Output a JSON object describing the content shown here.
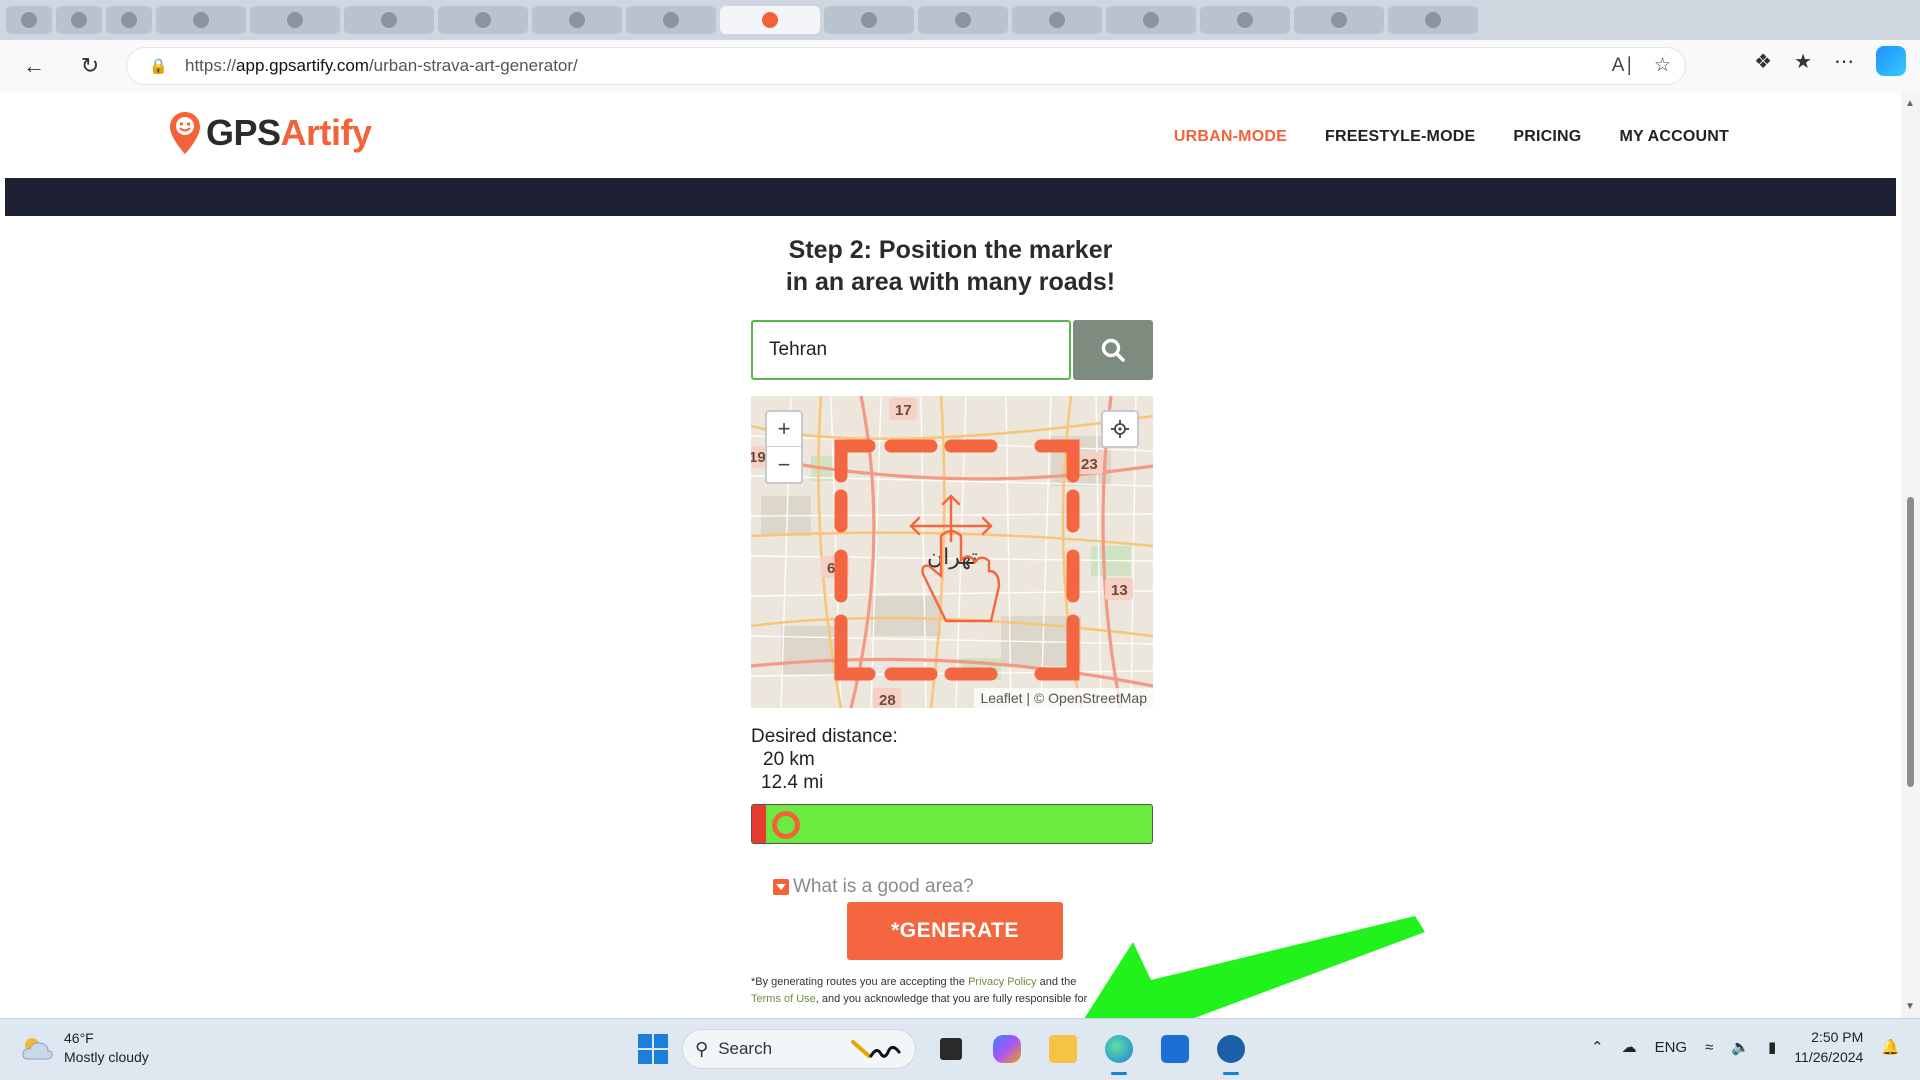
{
  "browser": {
    "url_prefix": "https://",
    "url_domain": "app.gpsartify.com",
    "url_path": "/urban-strava-art-generator/"
  },
  "site": {
    "logo_gps": "GPS",
    "logo_artify": "Artify",
    "nav": [
      {
        "label": "URBAN-MODE"
      },
      {
        "label": "FREESTYLE-MODE"
      },
      {
        "label": "PRICING"
      },
      {
        "label": "MY ACCOUNT"
      }
    ]
  },
  "step": {
    "title_line1": "Step 2: Position the marker",
    "title_line2": "in an area with many roads!"
  },
  "search": {
    "value": "Tehran"
  },
  "map": {
    "city_label": "تهران",
    "road_numbers": [
      "17",
      "19",
      "23",
      "67",
      "13",
      "28"
    ],
    "attribution_leaflet": "Leaflet",
    "attribution_sep": " | © ",
    "attribution_osm": "OpenStreetMap",
    "zoom_in": "+",
    "zoom_out": "−"
  },
  "distance": {
    "label": "Desired distance:",
    "km": "20 km",
    "mi": "12.4 mi",
    "slider_fraction": 0.035
  },
  "faq": {
    "label": "What is a good area?"
  },
  "generate": {
    "label": "*GENERATE"
  },
  "legal": {
    "part1": "*By generating routes you are accepting the ",
    "privacy": "Privacy Policy",
    "part2": " and the ",
    "terms": "Terms of Use",
    "part3": ", and you acknowledge that you are fully responsible for"
  },
  "taskbar": {
    "temp": "46°F",
    "weather": "Mostly cloudy",
    "search_label": "Search",
    "lang": "ENG",
    "time": "2:50 PM",
    "date": "11/26/2024"
  },
  "colors": {
    "brand_orange": "#f4623a",
    "annotation_arrow": "#22f21c",
    "slider_green": "#6bea3f",
    "slider_red": "#e63b2e"
  }
}
